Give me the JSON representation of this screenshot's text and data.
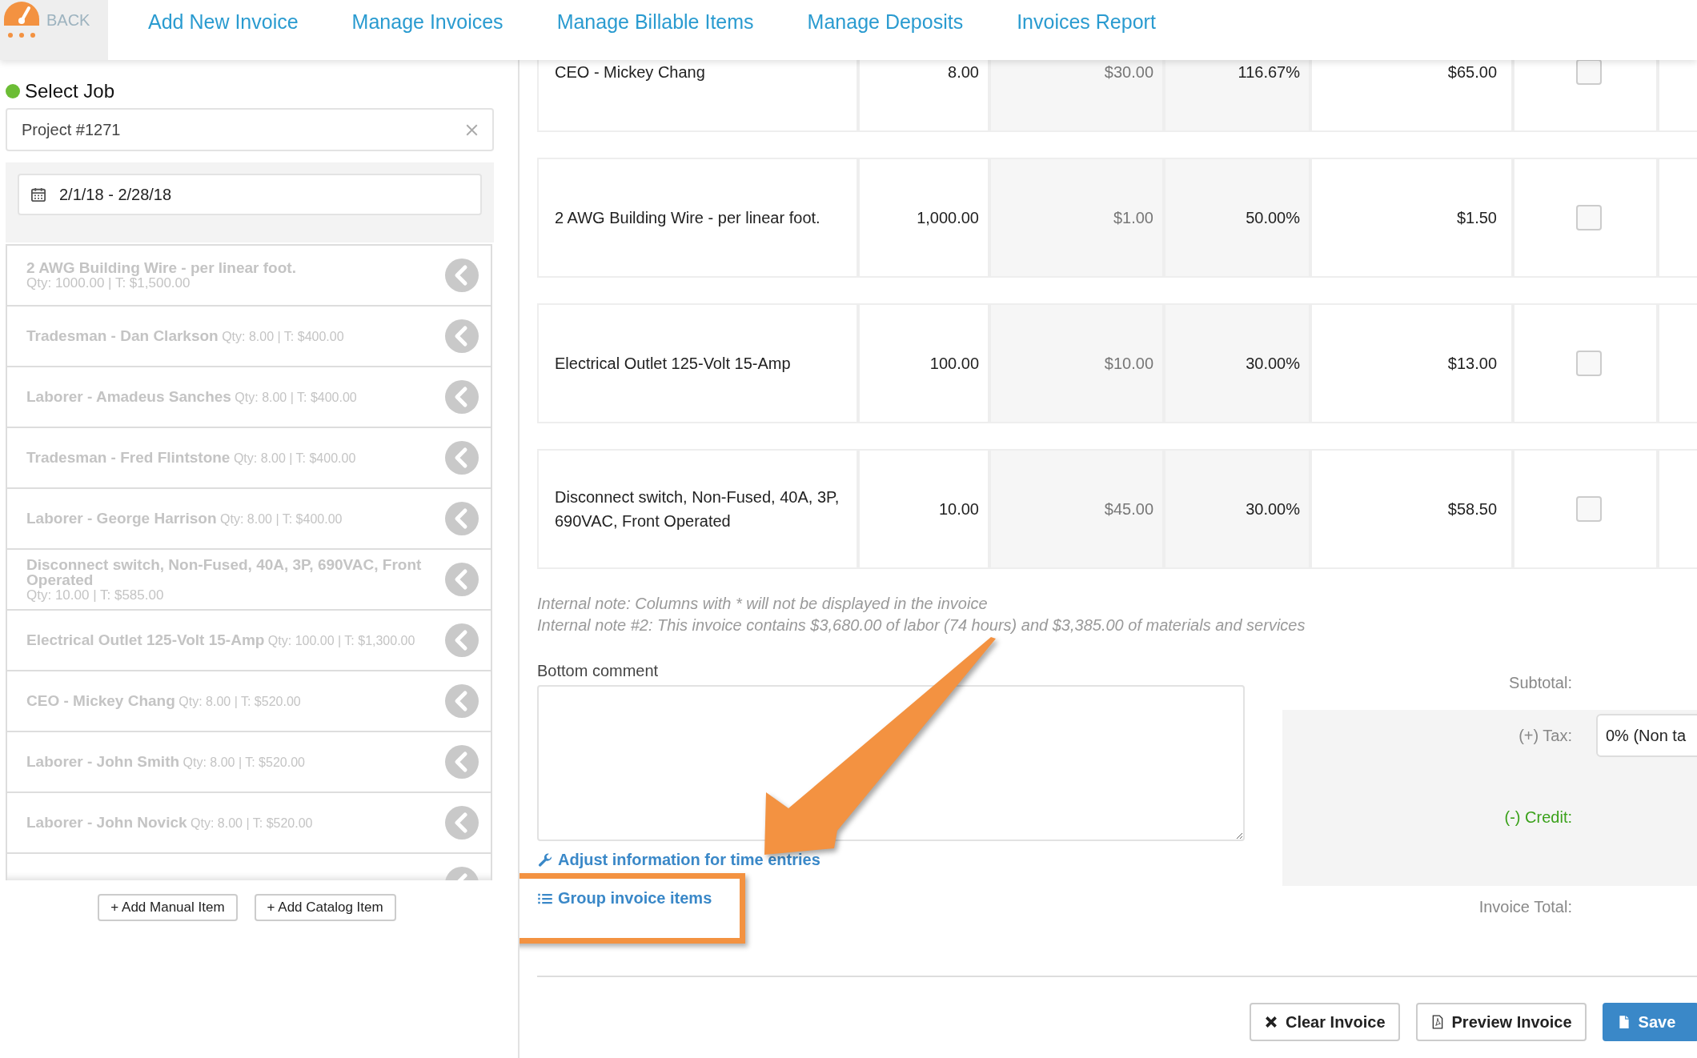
{
  "header": {
    "back_label": "BACK",
    "nav": [
      {
        "label": "Add New Invoice"
      },
      {
        "label": "Manage Invoices"
      },
      {
        "label": "Manage Billable Items"
      },
      {
        "label": "Manage Deposits"
      },
      {
        "label": "Invoices Report"
      }
    ]
  },
  "sidebar": {
    "job_label": "Select Job",
    "job_value": "Project #1271",
    "date_range": "2/1/18 - 2/28/18",
    "items": [
      {
        "kind": "stacked",
        "name": "2 AWG Building Wire - per linear foot.",
        "detail": "Qty: 1000.00 | T: $1,500.00"
      },
      {
        "kind": "inline",
        "name": "Tradesman - Dan Clarkson",
        "detail": "Qty: 8.00 | T: $400.00"
      },
      {
        "kind": "inline",
        "name": "Laborer - Amadeus Sanches",
        "detail": "Qty: 8.00 | T: $400.00"
      },
      {
        "kind": "inline",
        "name": "Tradesman - Fred Flintstone",
        "detail": "Qty: 8.00 | T: $400.00"
      },
      {
        "kind": "inline",
        "name": "Laborer - George Harrison",
        "detail": "Qty: 8.00 | T: $400.00"
      },
      {
        "kind": "stacked",
        "name": "Disconnect switch, Non-Fused, 40A, 3P, 690VAC, Front Operated",
        "detail": "Qty: 10.00 | T: $585.00"
      },
      {
        "kind": "inline",
        "name": "Electrical Outlet 125-Volt 15-Amp",
        "detail": "Qty: 100.00 | T: $1,300.00"
      },
      {
        "kind": "inline",
        "name": "CEO - Mickey Chang",
        "detail": "Qty: 8.00 | T: $520.00"
      },
      {
        "kind": "inline",
        "name": "Laborer - John Smith",
        "detail": "Qty: 8.00 | T: $520.00"
      },
      {
        "kind": "inline",
        "name": "Laborer - John Novick",
        "detail": "Qty: 8.00 | T: $520.00"
      },
      {
        "kind": "hidden"
      }
    ],
    "buttons": [
      "+ Add Manual Item",
      "+ Add Catalog Item"
    ]
  },
  "table": {
    "rows": [
      {
        "description": "CEO - Mickey Chang",
        "quantity": "8.00",
        "cost": "$30.00",
        "markup": "116.67%",
        "price": "$65.00",
        "checked": false
      },
      {
        "description": "2 AWG Building Wire - per linear foot.",
        "quantity": "1,000.00",
        "cost": "$1.00",
        "markup": "50.00%",
        "price": "$1.50",
        "checked": false
      },
      {
        "description": "Electrical Outlet 125-Volt 15-Amp",
        "quantity": "100.00",
        "cost": "$10.00",
        "markup": "30.00%",
        "price": "$13.00",
        "checked": false
      },
      {
        "description": "Disconnect switch, Non-Fused, 40A, 3P, 690VAC, Front Operated",
        "quantity": "10.00",
        "cost": "$45.00",
        "markup": "30.00%",
        "price": "$58.50",
        "checked": false
      }
    ]
  },
  "notes": [
    "Internal note: Columns with * will not be displayed in the invoice",
    "Internal note #2: This invoice contains $3,680.00 of labor (74 hours) and $3,385.00 of materials and services"
  ],
  "bottom_comment": {
    "label": "Bottom comment"
  },
  "links": [
    {
      "kind": "wrench",
      "label": "Adjust information for time entries",
      "highlighted": false
    },
    {
      "kind": "list",
      "label": "Group invoice items",
      "highlighted": true
    }
  ],
  "totals": {
    "subtotal_label": "Subtotal:",
    "tax_label": "(+) Tax:",
    "tax_value": "0% (Non ta",
    "credit_label": "(-) Credit:",
    "total_label": "Invoice Total:"
  },
  "actions": [
    {
      "kind": "clear",
      "label": "Clear Invoice"
    },
    {
      "kind": "preview",
      "label": "Preview Invoice"
    },
    {
      "kind": "save",
      "label": "Save"
    }
  ]
}
